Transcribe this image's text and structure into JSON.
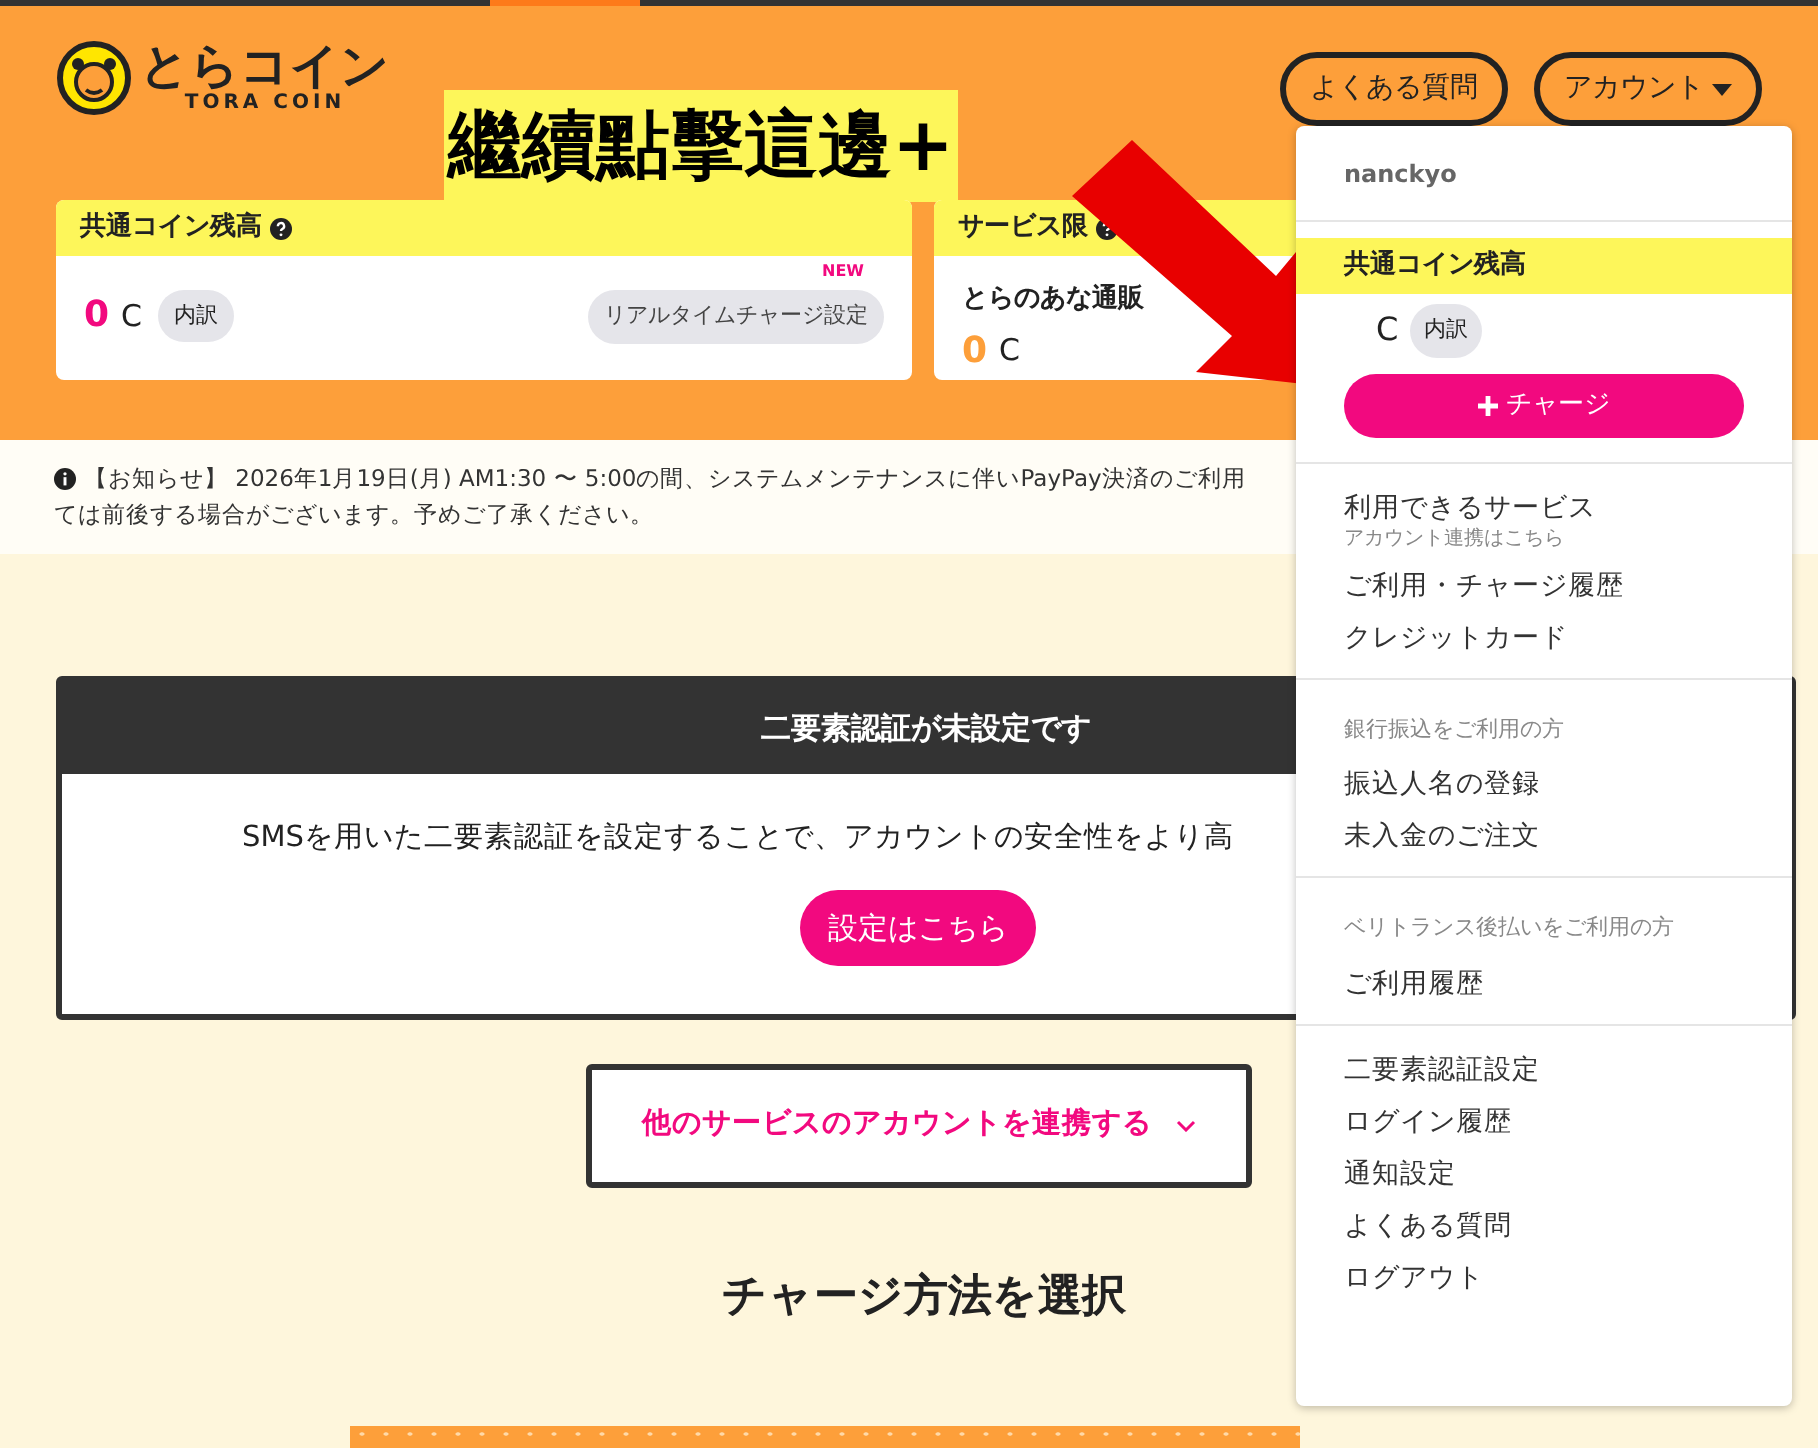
{
  "header": {
    "logo": {
      "name": "とらコイン",
      "subname": "TORA COIN"
    },
    "annotation": "繼續點擊這邊+",
    "nav_buttons": [
      {
        "label": "よくある質問",
        "kind": "plain"
      },
      {
        "label": "アカウント",
        "kind": "dropdown"
      }
    ]
  },
  "balance_cards": [
    {
      "title": "共通コイン残高",
      "help": true,
      "amount": "0",
      "unit": "C",
      "color": "#f2097f",
      "breakdown": "内訳",
      "realtime": {
        "badge": "NEW",
        "label": "リアルタイムチャージ設定"
      }
    },
    {
      "title": "サービス限",
      "help": true,
      "service": "とらのあな通販",
      "amount": "0",
      "unit": "C",
      "color": "#fd9f3a"
    }
  ],
  "notice": {
    "lines": [
      "【お知らせ】 2026年1月19日(月) AM1:30 〜 5:00の間、システムメンテナンスに伴いPayPay決済のご利用",
      "ては前後する場合がございます。予めご了承ください。"
    ]
  },
  "two_factor": {
    "title": "二要素認証が未設定です",
    "text": "SMSを用いた二要素認証を設定することで、アカウントの安全性をより高",
    "button": "設定はこちら"
  },
  "link_accounts": {
    "label": "他のサービスのアカウントを連携する"
  },
  "charge_heading": "チャージ方法を選択",
  "account_menu": {
    "username": "nanckyo",
    "balance_title": "共通コイン残高",
    "unit": "C",
    "breakdown": "内訳",
    "charge_button": "チャージ",
    "sections": [
      {
        "items": [
          {
            "label": "利用できるサービス",
            "sub": "アカウント連携はこちら"
          },
          {
            "label": "ご利用・チャージ履歴"
          },
          {
            "label": "クレジットカード"
          }
        ]
      },
      {
        "heading": "銀行振込をご利用の方",
        "items": [
          {
            "label": "振込人名の登録"
          },
          {
            "label": "未入金のご注文"
          }
        ]
      },
      {
        "heading": "ベリトランス後払いをご利用の方",
        "items": [
          {
            "label": "ご利用履歴"
          }
        ]
      },
      {
        "items": [
          {
            "label": "二要素認証設定"
          },
          {
            "label": "ログイン履歴"
          },
          {
            "label": "通知設定"
          },
          {
            "label": "よくある質問"
          },
          {
            "label": "ログアウト"
          }
        ]
      }
    ]
  }
}
